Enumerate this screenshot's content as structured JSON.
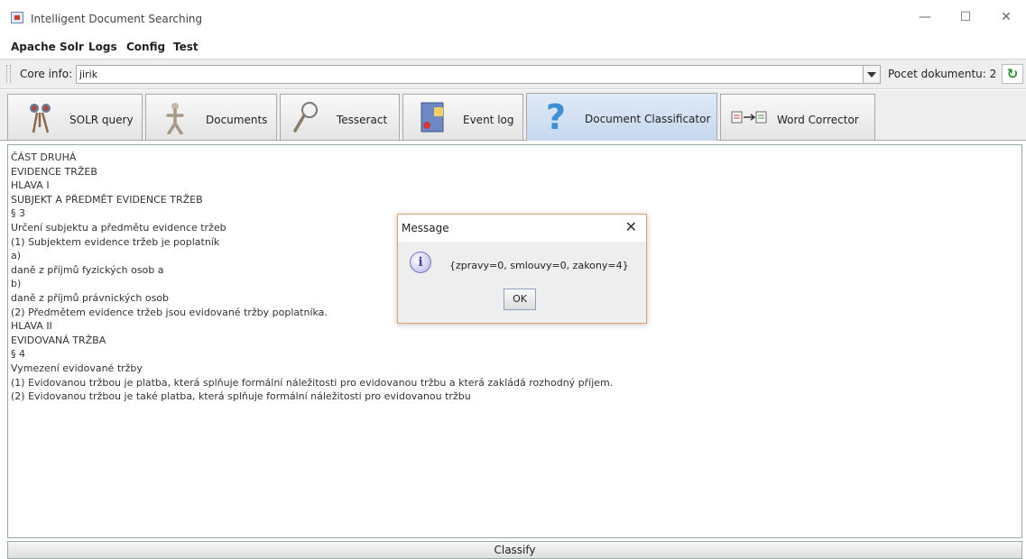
{
  "window": {
    "title": "Intelligent Document Searching"
  },
  "menubar": {
    "items": [
      {
        "label": "Apache Solr"
      },
      {
        "label": "Logs"
      },
      {
        "label": "Config"
      },
      {
        "label": "Test"
      }
    ]
  },
  "core": {
    "label": "Core info:",
    "value": "jirik",
    "count_label": "Pocet dokumentu: 2"
  },
  "tabs": [
    {
      "label": "SOLR query",
      "icon": "binoculars-icon"
    },
    {
      "label": "Documents",
      "icon": "documents-icon"
    },
    {
      "label": "Tesseract",
      "icon": "magnifier-icon"
    },
    {
      "label": "Event log",
      "icon": "event-log-icon"
    },
    {
      "label": "Document Classificator",
      "icon": "question-icon",
      "selected": true
    },
    {
      "label": "Word Corrector",
      "icon": "word-corrector-icon"
    }
  ],
  "document": {
    "lines": [
      "ČÁST DRUHÁ",
      "EVIDENCE TRŽEB",
      "HLAVA I",
      "SUBJEKT A PŘEDMĚT EVIDENCE TRŽEB",
      "§ 3",
      "Určení subjektu a předmětu evidence tržeb",
      "(1) Subjektem evidence tržeb je poplatník",
      "a)",
      "daně z příjmů fyzických osob a",
      "b)",
      "daně z příjmů právnických osob",
      "(2) Předmětem evidence tržeb jsou evidované tržby poplatníka.",
      "HLAVA II",
      "EVIDOVANÁ TRŽBA",
      "§ 4",
      "Vymezení evidované tržby",
      "(1) Evidovanou tržbou je platba, která splňuje formální náležitosti pro evidovanou tržbu a která zakládá rozhodný příjem.",
      "(2) Evidovanou tržbou je také platba, která splňuje formální náležitosti pro evidovanou tržbu"
    ]
  },
  "classify_button": {
    "label": "Classify"
  },
  "dialog": {
    "title": "Message",
    "message": "{zpravy=0, smlouvy=0, zakony=4}",
    "ok_label": "OK"
  },
  "colors": {
    "dialog_border": "#e0a46a",
    "active_tab": "#c6d8ee",
    "info_icon": "#4646a0"
  }
}
